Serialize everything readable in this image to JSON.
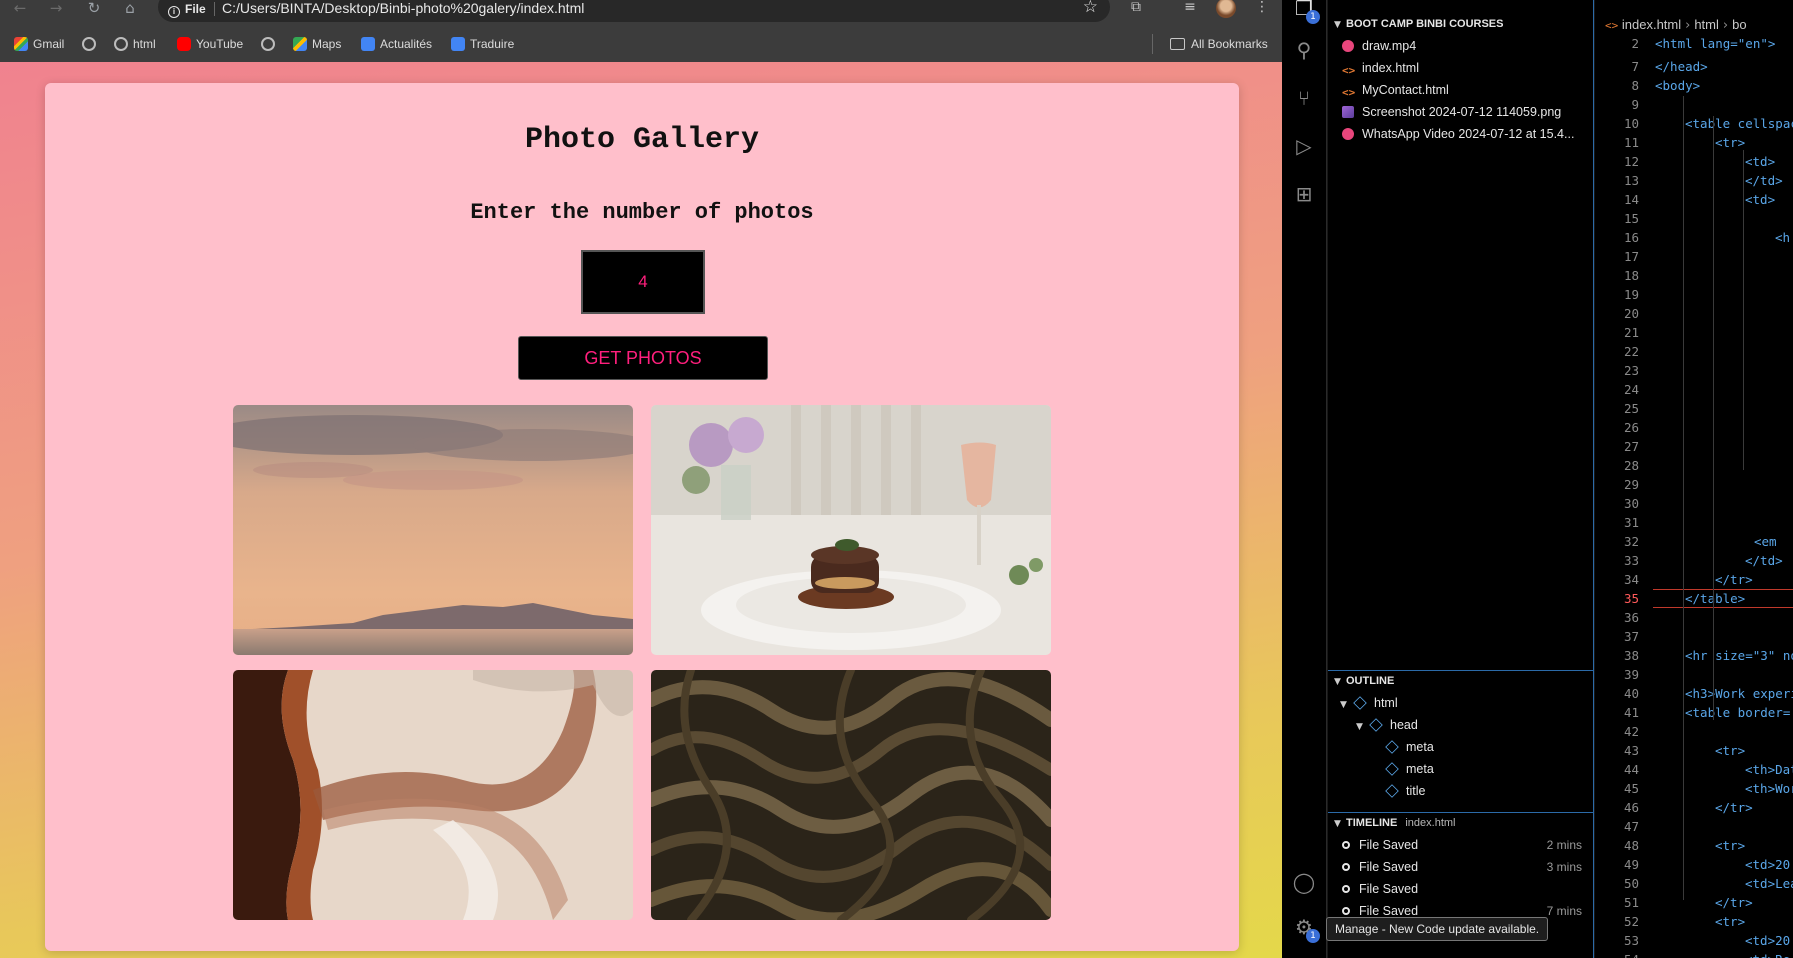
{
  "browser": {
    "url_chip": "File",
    "url": "C:/Users/BINTA/Desktop/Binbi-photo%20galery/index.html",
    "bookmarks": [
      {
        "label": "Gmail",
        "icon": "gmail-icon"
      },
      {
        "label": "",
        "icon": "globe-icon"
      },
      {
        "label": "html",
        "icon": "globe-icon"
      },
      {
        "label": "YouTube",
        "icon": "youtube-icon"
      },
      {
        "label": "",
        "icon": "globe-icon"
      },
      {
        "label": "Maps",
        "icon": "maps-icon"
      },
      {
        "label": "Actualités",
        "icon": "google-news-icon"
      },
      {
        "label": "Traduire",
        "icon": "google-translate-icon"
      }
    ],
    "all_bookmarks": "All Bookmarks"
  },
  "page": {
    "title": "Photo Gallery",
    "prompt": "Enter the number of photos",
    "number_value": "4",
    "button_label": "GET PHOTOS",
    "photos": [
      "sunset-sea-photo",
      "dessert-plate-photo",
      "aerial-beach-photo",
      "dark-fabric-photo"
    ],
    "accent_color": "#ff1f7d",
    "card_color": "#ffbfcb"
  },
  "vscode": {
    "explorer": {
      "folder": "BOOT CAMP BINBI COURSES",
      "files": [
        {
          "name": "draw.mp4",
          "kind": "video"
        },
        {
          "name": "index.html",
          "kind": "html"
        },
        {
          "name": "MyContact.html",
          "kind": "html"
        },
        {
          "name": "Screenshot 2024-07-12 114059.png",
          "kind": "png"
        },
        {
          "name": "WhatsApp Video 2024-07-12 at 15.4...",
          "kind": "video"
        }
      ]
    },
    "outline": {
      "header": "OUTLINE",
      "items": [
        {
          "label": "html",
          "level": 0,
          "expanded": true
        },
        {
          "label": "head",
          "level": 1,
          "expanded": true
        },
        {
          "label": "meta",
          "level": 2
        },
        {
          "label": "meta",
          "level": 2
        },
        {
          "label": "title",
          "level": 2
        }
      ]
    },
    "timeline": {
      "header": "TIMELINE",
      "file": "index.html",
      "items": [
        {
          "label": "File Saved",
          "when": "2 mins"
        },
        {
          "label": "File Saved",
          "when": "3 mins"
        },
        {
          "label": "File Saved",
          "when": ""
        },
        {
          "label": "File Saved",
          "when": "7 mins"
        }
      ]
    },
    "tooltip": "Manage - New Code update available.",
    "breadcrumbs": [
      "index.html",
      "html",
      "bo"
    ],
    "code_lines": [
      {
        "n": "2",
        "text": "<html lang=\"en\">"
      },
      {
        "n": "7",
        "text": "</head>"
      },
      {
        "n": "8",
        "text": "<body>"
      },
      {
        "n": "9",
        "text": ""
      },
      {
        "n": "10",
        "text": "<table cellspac"
      },
      {
        "n": "11",
        "text": "<tr>"
      },
      {
        "n": "12",
        "text": "<td>"
      },
      {
        "n": "13",
        "text": "</td>"
      },
      {
        "n": "14",
        "text": "<td>"
      },
      {
        "n": "15",
        "text": ""
      },
      {
        "n": "16",
        "text": "<h"
      },
      {
        "n": "17",
        "text": "<"
      },
      {
        "n": "18",
        "text": ""
      },
      {
        "n": "19",
        "text": ""
      },
      {
        "n": "20",
        "text": ""
      },
      {
        "n": "21",
        "text": ""
      },
      {
        "n": "22",
        "text": ""
      },
      {
        "n": "23",
        "text": ""
      },
      {
        "n": "24",
        "text": ""
      },
      {
        "n": "25",
        "text": ""
      },
      {
        "n": "26",
        "text": ""
      },
      {
        "n": "27",
        "text": ""
      },
      {
        "n": "28",
        "text": ""
      },
      {
        "n": "29",
        "text": ""
      },
      {
        "n": "30",
        "text": ""
      },
      {
        "n": "31",
        "text": ""
      },
      {
        "n": "32",
        "text": "<em"
      },
      {
        "n": "33",
        "text": "</td>"
      },
      {
        "n": "34",
        "text": "</tr>"
      },
      {
        "n": "35",
        "text": "</table>"
      },
      {
        "n": "36",
        "text": ""
      },
      {
        "n": "37",
        "text": ""
      },
      {
        "n": "38",
        "text": "<hr size=\"3\" no"
      },
      {
        "n": "39",
        "text": ""
      },
      {
        "n": "40",
        "text": "<h3>Work experi"
      },
      {
        "n": "41",
        "text": "<table border="
      },
      {
        "n": "42",
        "text": ""
      },
      {
        "n": "43",
        "text": "<tr>"
      },
      {
        "n": "44",
        "text": "<th>Dat"
      },
      {
        "n": "45",
        "text": "<th>Wor"
      },
      {
        "n": "46",
        "text": "</tr>"
      },
      {
        "n": "47",
        "text": ""
      },
      {
        "n": "48",
        "text": "<tr>"
      },
      {
        "n": "49",
        "text": "<td>20"
      },
      {
        "n": "50",
        "text": "<td>Lea"
      },
      {
        "n": "51",
        "text": "</tr>"
      },
      {
        "n": "52",
        "text": "<tr>"
      },
      {
        "n": "53",
        "text": "<td>20"
      },
      {
        "n": "54",
        "text": "<td>Re"
      }
    ]
  }
}
